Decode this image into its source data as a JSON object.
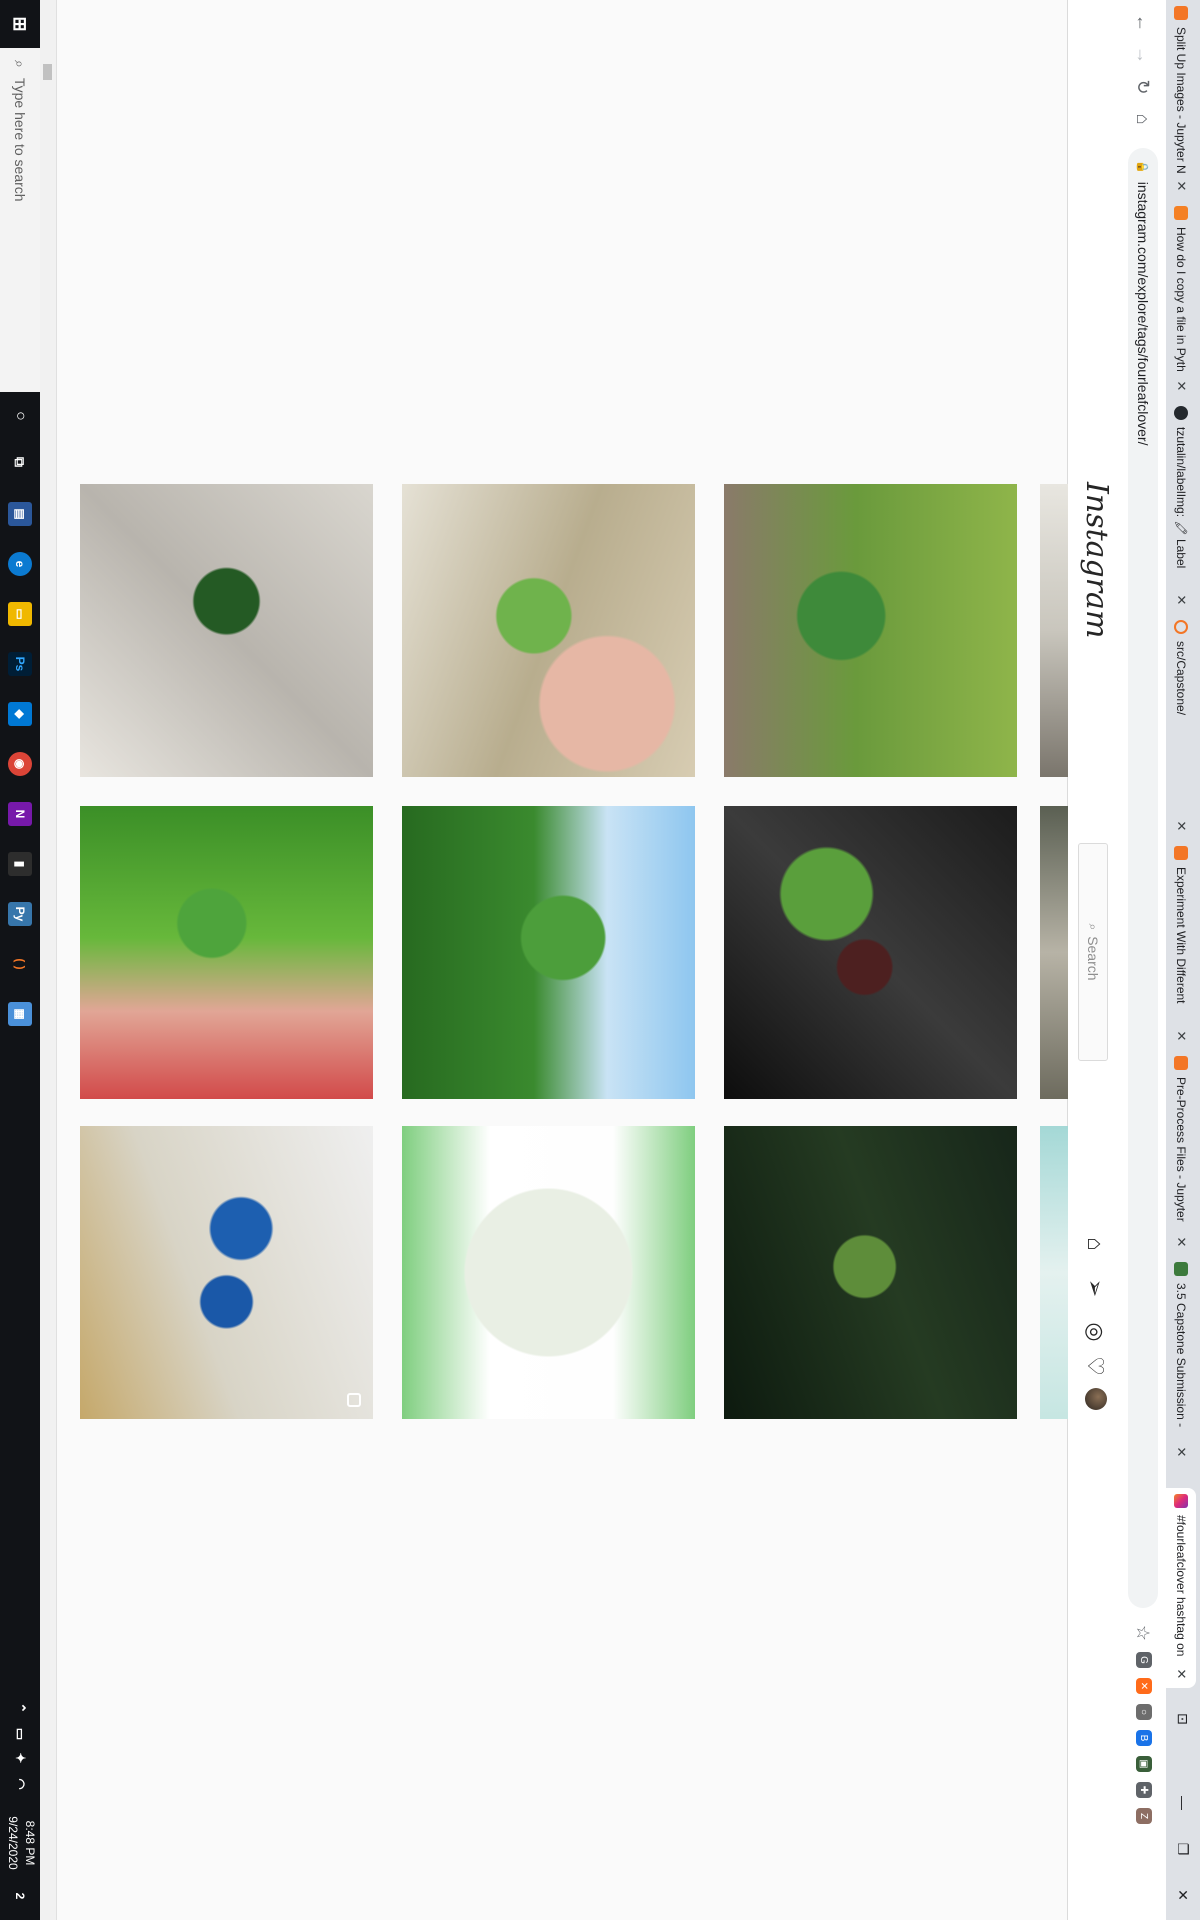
{
  "browser": {
    "tabs": [
      {
        "title": "Split Up Images - Jupyter N",
        "favicon_color": "#f37626",
        "active": false
      },
      {
        "title": "How do I copy a file in Pyth",
        "favicon_color": "#f48024",
        "active": false
      },
      {
        "title": "tzutalin/labelImg: 🖍 Label",
        "favicon_color": "#24292e",
        "active": false
      },
      {
        "title": "src/Capstone/",
        "favicon_color": "#f37626",
        "active": false
      },
      {
        "title": "Experiment With Different",
        "favicon_color": "#f37626",
        "active": false
      },
      {
        "title": "Pre-Process Files - Jupyter",
        "favicon_color": "#f37626",
        "active": false
      },
      {
        "title": "3.5 Capstone Submission -",
        "favicon_color": "#3c7a3c",
        "active": false
      },
      {
        "title": "#fourleafclover hashtag on",
        "favicon_color": "#e1306c",
        "active": true
      }
    ],
    "url": "instagram.com/explore/tags/fourleafclover/",
    "extensions": [
      {
        "name": "g-extension-icon",
        "color": "#5f6368",
        "glyph": "G"
      },
      {
        "name": "x-extension-icon",
        "color": "#ff6b1a",
        "glyph": "✕"
      },
      {
        "name": "circle-extension-icon",
        "color": "#6d6d6d",
        "glyph": "○"
      },
      {
        "name": "b-extension-icon",
        "color": "#1a73e8",
        "glyph": "B"
      },
      {
        "name": "green-extension-icon",
        "color": "#3a5f3a",
        "glyph": "▣"
      },
      {
        "name": "puzzle-extension-icon",
        "color": "#5f6368",
        "glyph": "✚"
      },
      {
        "name": "profile-icon",
        "color": "#8d6e63",
        "glyph": "Z"
      }
    ]
  },
  "instagram": {
    "logo": "Instagram",
    "search_placeholder": "Search"
  },
  "taskbar": {
    "search_placeholder": "Type here to search",
    "time": "8:48 PM",
    "date": "9/24/2020",
    "notification_count": "2"
  }
}
